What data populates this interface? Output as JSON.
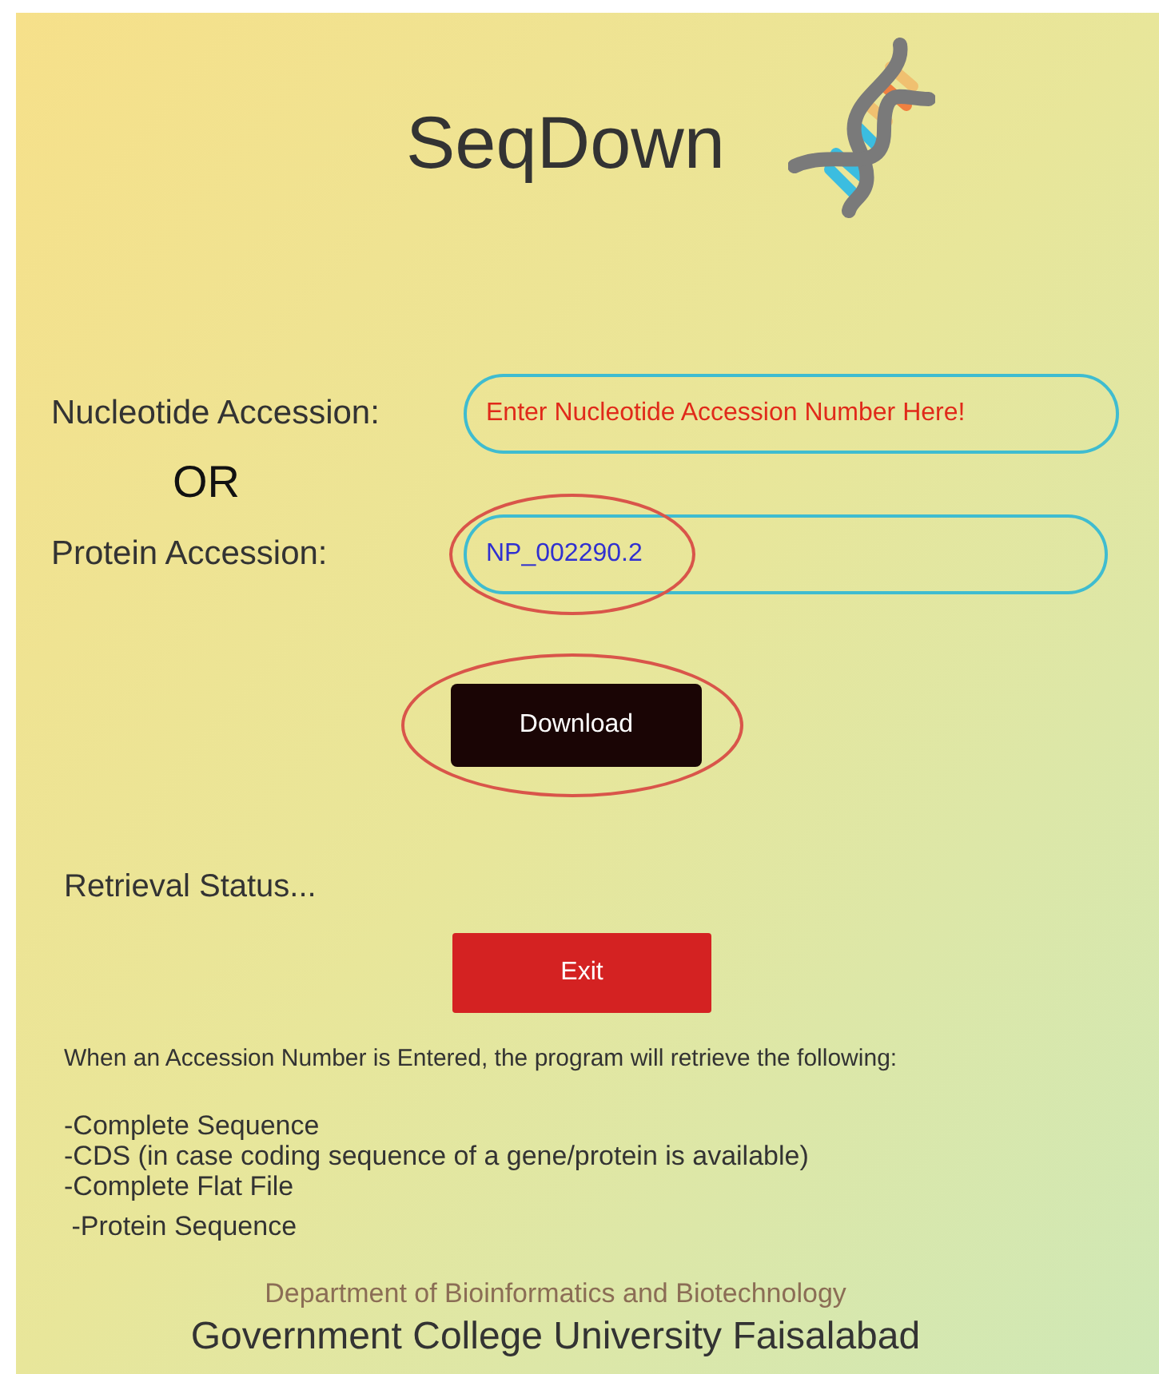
{
  "app": {
    "title": "SeqDown"
  },
  "fields": [
    {
      "label": "Nucleotide Accession:",
      "placeholder": "Enter Nucleotide Accession Number Here!",
      "circled": false
    },
    {
      "label": "Protein Accession:",
      "value": "NP_002290.2",
      "circled": true
    }
  ],
  "or_text": "OR",
  "download_button": {
    "label": "Download",
    "circled": true
  },
  "status": "Retrieval Status...",
  "exit_button": {
    "label": "Exit",
    "circled": false
  },
  "info": "When an Accession Number is Entered, the program will retrieve the following:",
  "retrieved_items": [
    "-Complete Sequence",
    "-CDS (in case coding sequence of a gene/protein is available)",
    "-Complete Flat File",
    " -Protein Sequence"
  ],
  "footer": {
    "department": "Department of Bioinformatics and Biotechnology",
    "university": "Government College University Faisalabad"
  }
}
